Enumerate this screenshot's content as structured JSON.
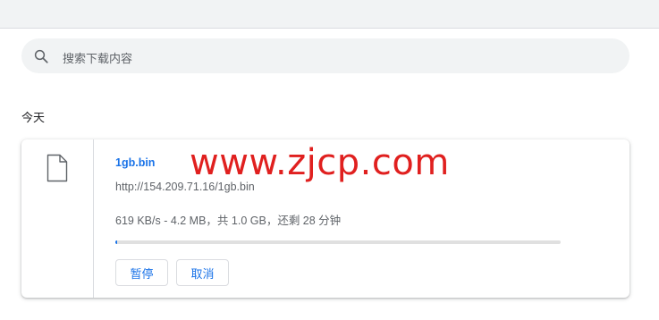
{
  "search": {
    "placeholder": "搜索下载内容",
    "icon": "search-icon"
  },
  "section": {
    "title": "今天"
  },
  "download": {
    "file_name": "1gb.bin",
    "url": "http://154.209.71.16/1gb.bin",
    "status": "619 KB/s - 4.2 MB，共 1.0 GB，还剩 28 分钟",
    "progress_fraction": 0.004,
    "file_icon": "file-icon",
    "buttons": {
      "pause": "暂停",
      "cancel": "取消"
    }
  },
  "watermark": {
    "text": "www.zjcp.com"
  },
  "colors": {
    "accent": "#1a73e8",
    "watermark": "#e0201f",
    "background": "#f1f3f4"
  }
}
